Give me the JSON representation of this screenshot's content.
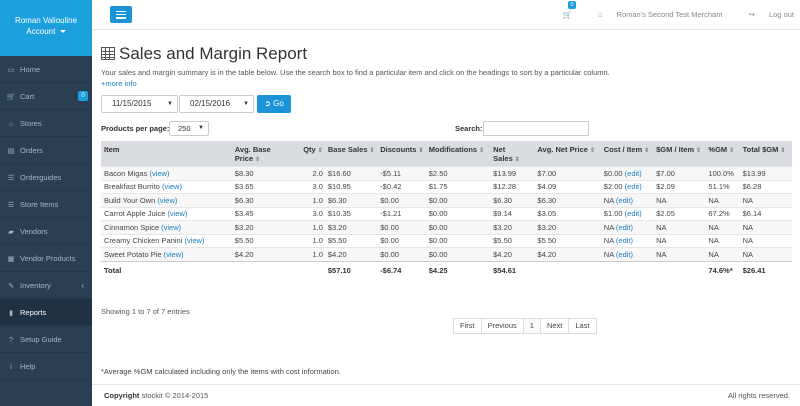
{
  "sidebar": {
    "user_name": "Roman Valiouline",
    "account_label": "Account",
    "items": [
      {
        "label": "Home",
        "icon": "laptop-icon",
        "glyph": "▭"
      },
      {
        "label": "Cart",
        "icon": "cart-icon",
        "glyph": "🛒",
        "badge": "0"
      },
      {
        "label": "Stores",
        "icon": "bank-icon",
        "glyph": "⌂"
      },
      {
        "label": "Orders",
        "icon": "folder-icon",
        "glyph": "▤"
      },
      {
        "label": "Orderguides",
        "icon": "list-icon",
        "glyph": "☰"
      },
      {
        "label": "Store Items",
        "icon": "list-icon",
        "glyph": "☰"
      },
      {
        "label": "Vendors",
        "icon": "truck-icon",
        "glyph": "▰"
      },
      {
        "label": "Vendor Products",
        "icon": "products-icon",
        "glyph": "▦"
      },
      {
        "label": "Inventory",
        "icon": "pencil-icon",
        "glyph": "✎",
        "chevron": "‹"
      },
      {
        "label": "Reports",
        "icon": "chart-icon",
        "glyph": "▮",
        "active": true
      },
      {
        "label": "Setup Guide",
        "icon": "question-icon",
        "glyph": "?"
      },
      {
        "label": "Help",
        "icon": "info-icon",
        "glyph": "i"
      }
    ]
  },
  "topbar": {
    "cart_badge": "0",
    "merchant": "Roman's Second Test Merchant",
    "logout": "Log out"
  },
  "page": {
    "title": "Sales and Margin Report",
    "intro": "Your sales and margin summary is in the table below. Use the search box to find a particular item and click on the headings to sort by a particular column.",
    "more_info": "+more info",
    "date_from": "11/15/2015",
    "date_to": "02/15/2016",
    "go_label": "Go",
    "per_page_label": "Products per page:",
    "per_page_value": "250",
    "search_label": "Search:",
    "search_value": ""
  },
  "table": {
    "columns": [
      "Item",
      "Avg. Base Price",
      "Qty",
      "Base Sales",
      "Discounts",
      "Modifications",
      "Net Sales",
      "Avg. Net Price",
      "Cost / Item",
      "$GM / Item",
      "%GM",
      "Total $GM"
    ],
    "rows": [
      {
        "item": "Bacon Migas",
        "avg_base": "$8.30",
        "qty": "2.0",
        "base_sales": "$16.60",
        "discounts": "-$5.11",
        "mods": "$2.50",
        "net_sales": "$13.99",
        "avg_net": "$7.00",
        "cost": "$0.00",
        "gm_item": "$7.00",
        "pct_gm": "100.0%",
        "total_gm": "$13.99"
      },
      {
        "item": "Breakfast Burrito",
        "avg_base": "$3.65",
        "qty": "3.0",
        "base_sales": "$10.95",
        "discounts": "-$0.42",
        "mods": "$1.75",
        "net_sales": "$12.28",
        "avg_net": "$4.09",
        "cost": "$2.00",
        "gm_item": "$2.09",
        "pct_gm": "51.1%",
        "total_gm": "$6.28"
      },
      {
        "item": "Build Your Own",
        "avg_base": "$6.30",
        "qty": "1.0",
        "base_sales": "$6.30",
        "discounts": "$0.00",
        "mods": "$0.00",
        "net_sales": "$6.30",
        "avg_net": "$6.30",
        "cost": "NA",
        "gm_item": "NA",
        "pct_gm": "NA",
        "total_gm": "NA"
      },
      {
        "item": "Carrot Apple Juice",
        "avg_base": "$3.45",
        "qty": "3.0",
        "base_sales": "$10.35",
        "discounts": "-$1.21",
        "mods": "$0.00",
        "net_sales": "$9.14",
        "avg_net": "$3.05",
        "cost": "$1.00",
        "gm_item": "$2.05",
        "pct_gm": "67.2%",
        "total_gm": "$6.14"
      },
      {
        "item": "Cinnamon Spice",
        "avg_base": "$3.20",
        "qty": "1.0",
        "base_sales": "$3.20",
        "discounts": "$0.00",
        "mods": "$0.00",
        "net_sales": "$3.20",
        "avg_net": "$3.20",
        "cost": "NA",
        "gm_item": "NA",
        "pct_gm": "NA",
        "total_gm": "NA"
      },
      {
        "item": "Creamy Chicken Panini",
        "avg_base": "$5.50",
        "qty": "1.0",
        "base_sales": "$5.50",
        "discounts": "$0.00",
        "mods": "$0.00",
        "net_sales": "$5.50",
        "avg_net": "$5.50",
        "cost": "NA",
        "gm_item": "NA",
        "pct_gm": "NA",
        "total_gm": "NA"
      },
      {
        "item": "Sweet Potato Pie",
        "avg_base": "$4.20",
        "qty": "1.0",
        "base_sales": "$4.20",
        "discounts": "$0.00",
        "mods": "$0.00",
        "net_sales": "$4.20",
        "avg_net": "$4.20",
        "cost": "NA",
        "gm_item": "NA",
        "pct_gm": "NA",
        "total_gm": "NA"
      }
    ],
    "view_label": "(view)",
    "edit_label": "(edit)",
    "total": {
      "label": "Total",
      "base_sales": "$57.10",
      "discounts": "-$6.74",
      "mods": "$4.25",
      "net_sales": "$54.61",
      "pct_gm": "74.6%*",
      "total_gm": "$26.41"
    }
  },
  "pagination": {
    "showing": "Showing 1 to 7 of 7 entries",
    "first": "First",
    "previous": "Previous",
    "current": "1",
    "next": "Next",
    "last": "Last"
  },
  "footnote": "*Average %GM calculated including only the items with cost information.",
  "footer": {
    "copyright_bold": "Copyright",
    "copyright_rest": "stockit © 2014-2015",
    "rights": "All rights reserved."
  },
  "colors": {
    "sidebar": "#2a3f54",
    "accent": "#1a94d6",
    "link": "#1a7ec0"
  }
}
